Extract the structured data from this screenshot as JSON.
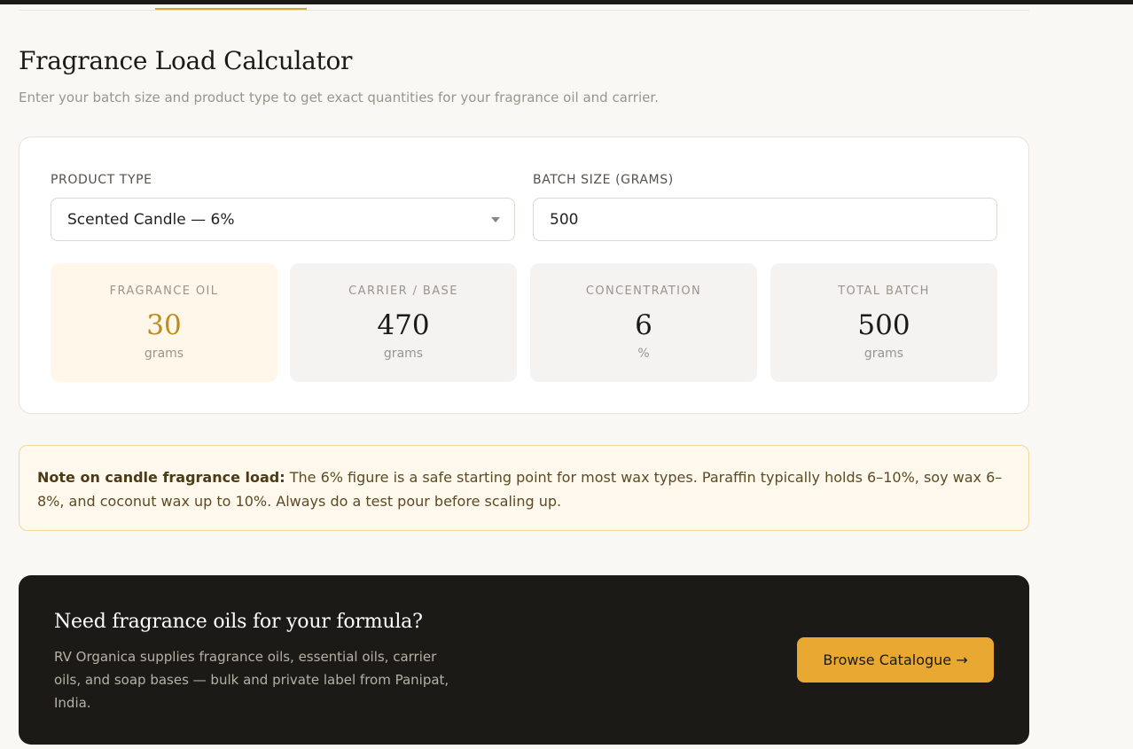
{
  "header": {
    "title": "Fragrance Load Calculator",
    "subtitle": "Enter your batch size and product type to get exact quantities for your fragrance oil and carrier."
  },
  "form": {
    "product_type_label": "PRODUCT TYPE",
    "product_type_value": "Scented Candle — 6%",
    "batch_size_label": "BATCH SIZE (GRAMS)",
    "batch_size_value": "500"
  },
  "results": [
    {
      "label": "FRAGRANCE OIL",
      "value": "30",
      "unit": "grams"
    },
    {
      "label": "CARRIER / BASE",
      "value": "470",
      "unit": "grams"
    },
    {
      "label": "CONCENTRATION",
      "value": "6",
      "unit": "%"
    },
    {
      "label": "TOTAL BATCH",
      "value": "500",
      "unit": "grams"
    }
  ],
  "note": {
    "heading": "Note on candle fragrance load:",
    "body": " The 6% figure is a safe starting point for most wax types. Paraffin typically holds 6–10%, soy wax 6–8%, and coconut wax up to 10%. Always do a test pour before scaling up."
  },
  "cta": {
    "title": "Need fragrance oils for your formula?",
    "text": "RV Organica supplies fragrance oils, essential oils, carrier oils, and soap bases — bulk and private label from Panipat, India.",
    "button_label": "Browse Catalogue →"
  },
  "colors": {
    "accent": "#e8a832",
    "dark": "#1c1a17",
    "highlight_value": "#c08a1e"
  }
}
